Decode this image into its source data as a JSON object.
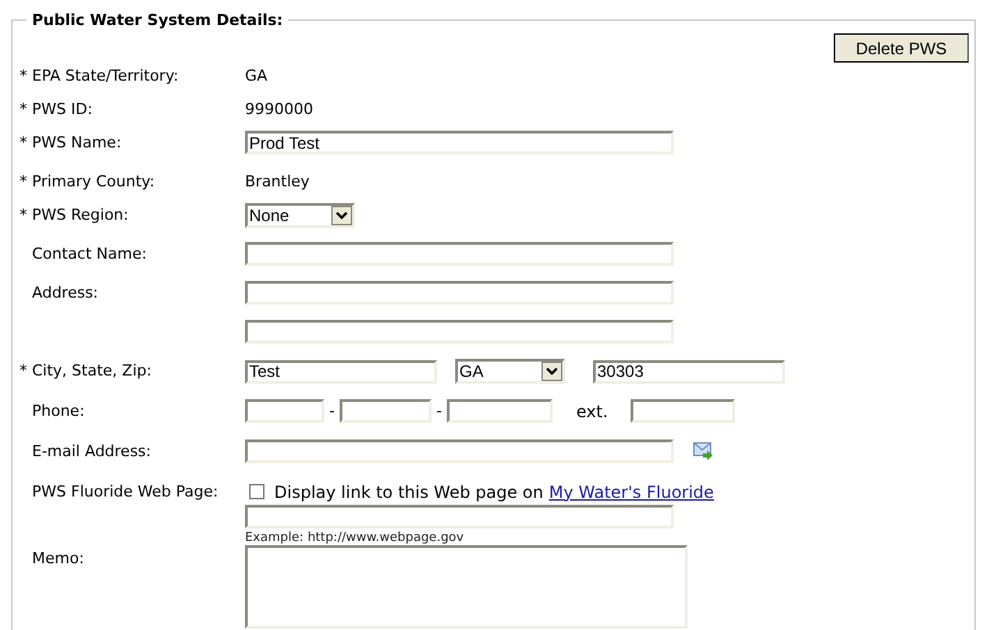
{
  "legend": "Public Water System Details:",
  "delete_button": "Delete PWS",
  "rows": [
    {
      "kind": "static",
      "marker": "*",
      "label": "EPA State/Territory:",
      "value": "GA"
    },
    {
      "kind": "static",
      "marker": "*",
      "label": "PWS ID:",
      "value": "9990000"
    },
    {
      "kind": "text",
      "marker": "*",
      "label": "PWS Name:",
      "value": "Prod Test"
    },
    {
      "kind": "static",
      "marker": "*",
      "label": "Primary County:",
      "value": "Brantley"
    },
    {
      "kind": "select",
      "marker": "*",
      "label": "PWS Region:",
      "value": "None"
    },
    {
      "kind": "text",
      "label": "Contact Name:"
    },
    {
      "kind": "text",
      "label": "Address:"
    },
    {
      "kind": "text"
    },
    {
      "kind": "city",
      "marker": "*",
      "label": "City, State, Zip:",
      "city": "Test",
      "state": "GA",
      "zip": "30303"
    },
    {
      "kind": "phone",
      "label": "Phone:",
      "separators": [
        "-",
        "-"
      ],
      "ext_label": "ext."
    },
    {
      "kind": "email",
      "label": "E-mail Address:"
    },
    {
      "kind": "fluoride",
      "label": "PWS Fluoride Web Page:",
      "checked": false,
      "text": "Display link to this Web page on",
      "link": "My Water's Fluoride",
      "hint": "Example: http://www.webpage.gov"
    },
    {
      "kind": "memo",
      "label": "Memo:"
    }
  ]
}
